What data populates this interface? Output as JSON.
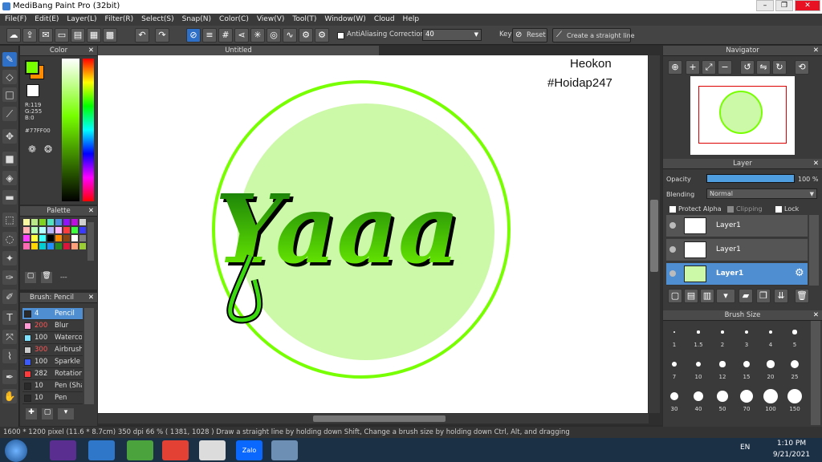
{
  "window": {
    "title": "MediBang Paint Pro (32bit)"
  },
  "menu": [
    "File(F)",
    "Edit(E)",
    "Layer(L)",
    "Filter(R)",
    "Select(S)",
    "Snap(N)",
    "Color(C)",
    "View(V)",
    "Tool(T)",
    "Window(W)",
    "Cloud",
    "Help"
  ],
  "toolbar": {
    "antialiasing_label": "AntiAliasing",
    "correction_label": "Correction",
    "correction_value": "40",
    "key_label": "Key",
    "reset_label": "Reset",
    "straight_line_label": "Create a straight line"
  },
  "color_panel": {
    "title": "Color",
    "r": "R:119",
    "g": "G:255",
    "b": "B:0",
    "hex": "#77FF00",
    "primary": "#77FF00",
    "secondary": "#FF8C00"
  },
  "palette_panel": {
    "title": "Palette",
    "colors": [
      "#f8f8a0",
      "#b8e986",
      "#7ed321",
      "#50e3c2",
      "#4a90e2",
      "#9013fe",
      "#bd10e0",
      "#d0d0d0",
      "#ffb3b3",
      "#b3ffb3",
      "#b3ffff",
      "#b3b3ff",
      "#ffb3ff",
      "#ff3b3b",
      "#3bff3b",
      "#3b3bff",
      "#ff3bff",
      "#ffff3b",
      "#3bffff",
      "#000000",
      "#ff8c00",
      "#8b4513",
      "#ffffff",
      "#7f7f7f",
      "#ff69b4",
      "#ffd700",
      "#00ced1",
      "#1e90ff",
      "#228b22",
      "#dc143c",
      "#ffa07a",
      "#9acd32"
    ],
    "footer": "---"
  },
  "brush_panel": {
    "title": "Brush: Pencil",
    "items": [
      {
        "size": "4",
        "name": "Pencil",
        "color": "#2a2a2a"
      },
      {
        "size": "200",
        "name": "Blur",
        "color": "#ff9ad5"
      },
      {
        "size": "100",
        "name": "Watercolor",
        "color": "#7fe0ff"
      },
      {
        "size": "300",
        "name": "Airbrush",
        "color": "#cccccc"
      },
      {
        "size": "100",
        "name": "Sparkle Brush",
        "color": "#3b5bff"
      },
      {
        "size": "282",
        "name": "Rotation",
        "color": "#ff3b3b"
      },
      {
        "size": "10",
        "name": "Pen (Sharp)",
        "color": "#2a2a2a"
      },
      {
        "size": "10",
        "name": "Pen",
        "color": "#2a2a2a"
      }
    ]
  },
  "canvas": {
    "doc_tab": "Untitled",
    "watermark_line1": "Heokon",
    "watermark_line2": "#Hoidap247",
    "artwork_text": "Yaaa",
    "ring_color": "#77FF00",
    "fill_color": "#CCF9A8"
  },
  "navigator": {
    "title": "Navigator"
  },
  "layer_panel": {
    "title": "Layer",
    "opacity_label": "Opacity",
    "opacity_value": "100 %",
    "opacity_fraction": 1.0,
    "blending_label": "Blending",
    "blending_value": "Normal",
    "protect_alpha": "Protect Alpha",
    "clipping": "Clipping",
    "lock": "Lock",
    "layers": [
      {
        "name": "Layer1",
        "selected": false
      },
      {
        "name": "Layer1",
        "selected": false
      },
      {
        "name": "Layer1",
        "selected": true
      }
    ]
  },
  "brush_size_panel": {
    "title": "Brush Size",
    "sizes": [
      "1",
      "1.5",
      "2",
      "3",
      "4",
      "5",
      "7",
      "10",
      "12",
      "15",
      "20",
      "25",
      "30",
      "40",
      "50",
      "70",
      "100",
      "150"
    ]
  },
  "status": {
    "text": "1600 * 1200 pixel   (11.6 * 8.7cm)   350 dpi   66 %   ( 1381, 1028 )   Draw a straight line by holding down Shift, Change a brush size by holding down Ctrl, Alt, and dragging"
  },
  "taskbar": {
    "lang": "EN",
    "time": "1:10 PM",
    "date": "9/21/2021",
    "apps": [
      "visual-studio-icon",
      "internet-explorer-icon",
      "coc-coc-browser-icon",
      "chrome-icon",
      "google-photos-icon",
      "zalo-icon",
      "paint-palette-icon"
    ],
    "zalo_label": "Zalo"
  }
}
